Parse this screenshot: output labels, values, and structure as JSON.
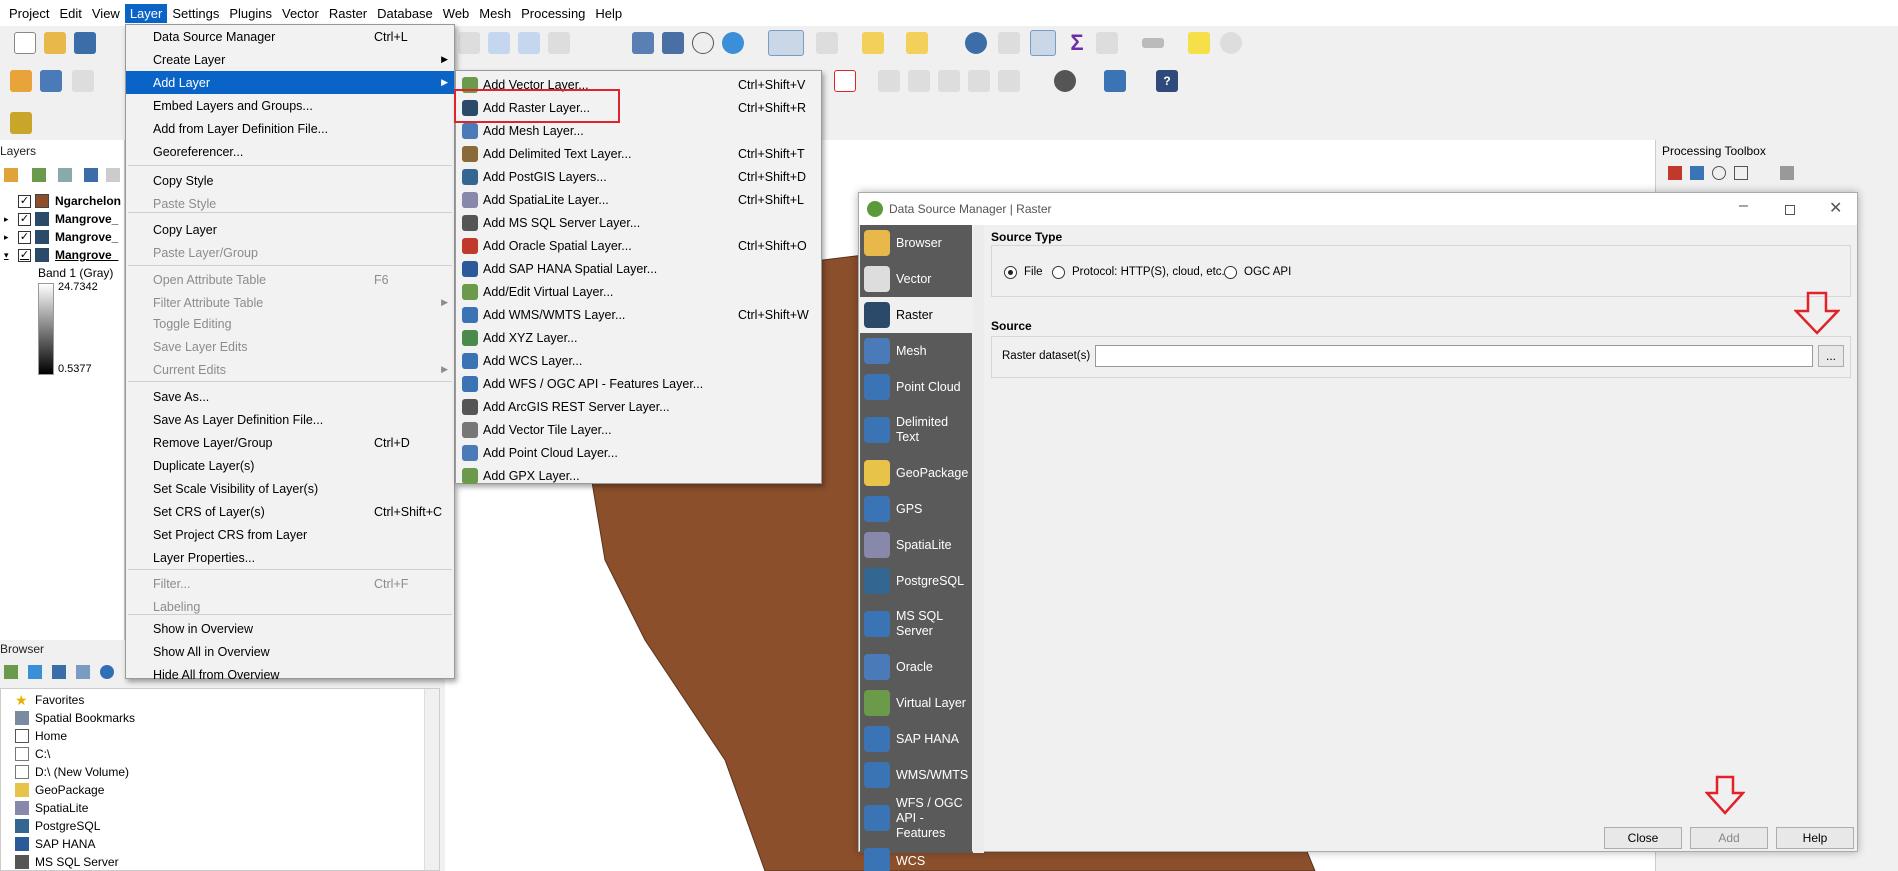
{
  "menubar": [
    "Project",
    "Edit",
    "View",
    "Layer",
    "Settings",
    "Plugins",
    "Vector",
    "Raster",
    "Database",
    "Web",
    "Mesh",
    "Processing",
    "Help"
  ],
  "layers_panel": {
    "title": "Layers",
    "layers": [
      {
        "name": "Ngarchelon",
        "checked": true
      },
      {
        "name": "Mangrove_",
        "checked": true
      },
      {
        "name": "Mangrove_",
        "checked": true
      },
      {
        "name": "Mangrove_",
        "checked": true
      }
    ],
    "band_label": "Band 1 (Gray)",
    "max_value": "24.7342",
    "min_value": "0.5377"
  },
  "browser_panel": {
    "title": "Browser",
    "items": [
      "Favorites",
      "Spatial Bookmarks",
      "Home",
      "C:\\",
      "D:\\ (New Volume)",
      "GeoPackage",
      "SpatiaLite",
      "PostgreSQL",
      "SAP HANA",
      "MS SQL Server"
    ]
  },
  "processing_toolbox": {
    "title": "Processing Toolbox"
  },
  "layer_menu": [
    {
      "label": "Data Source Manager",
      "shortcut": "Ctrl+L",
      "disabled": false
    },
    {
      "label": "Create Layer",
      "submenu": true
    },
    {
      "label": "Add Layer",
      "submenu": true,
      "highlight": true
    },
    {
      "label": "Embed Layers and Groups..."
    },
    {
      "label": "Add from Layer Definition File..."
    },
    {
      "label": "Georeferencer..."
    },
    {
      "label": "Copy Style"
    },
    {
      "label": "Paste Style",
      "disabled": true
    },
    {
      "label": "Copy Layer"
    },
    {
      "label": "Paste Layer/Group",
      "disabled": true
    },
    {
      "label": "Open Attribute Table",
      "shortcut": "F6",
      "disabled": true
    },
    {
      "label": "Filter Attribute Table",
      "submenu": true,
      "disabled": true
    },
    {
      "label": "Toggle Editing",
      "disabled": true
    },
    {
      "label": "Save Layer Edits",
      "disabled": true
    },
    {
      "label": "Current Edits",
      "submenu": true,
      "disabled": true
    },
    {
      "label": "Save As..."
    },
    {
      "label": "Save As Layer Definition File..."
    },
    {
      "label": "Remove Layer/Group",
      "shortcut": "Ctrl+D"
    },
    {
      "label": "Duplicate Layer(s)"
    },
    {
      "label": "Set Scale Visibility of Layer(s)"
    },
    {
      "label": "Set CRS of Layer(s)",
      "shortcut": "Ctrl+Shift+C"
    },
    {
      "label": "Set Project CRS from Layer"
    },
    {
      "label": "Layer Properties..."
    },
    {
      "label": "Filter...",
      "shortcut": "Ctrl+F",
      "disabled": true
    },
    {
      "label": "Labeling",
      "disabled": true
    },
    {
      "label": "Show in Overview"
    },
    {
      "label": "Show All in Overview"
    },
    {
      "label": "Hide All from Overview"
    }
  ],
  "add_layer_menu": [
    {
      "label": "Add Vector Layer...",
      "shortcut": "Ctrl+Shift+V"
    },
    {
      "label": "Add Raster Layer...",
      "shortcut": "Ctrl+Shift+R"
    },
    {
      "label": "Add Mesh Layer..."
    },
    {
      "label": "Add Delimited Text Layer...",
      "shortcut": "Ctrl+Shift+T"
    },
    {
      "label": "Add PostGIS Layers...",
      "shortcut": "Ctrl+Shift+D"
    },
    {
      "label": "Add SpatiaLite Layer...",
      "shortcut": "Ctrl+Shift+L"
    },
    {
      "label": "Add MS SQL Server Layer..."
    },
    {
      "label": "Add Oracle Spatial Layer...",
      "shortcut": "Ctrl+Shift+O"
    },
    {
      "label": "Add SAP HANA Spatial Layer..."
    },
    {
      "label": "Add/Edit Virtual Layer..."
    },
    {
      "label": "Add WMS/WMTS Layer...",
      "shortcut": "Ctrl+Shift+W"
    },
    {
      "label": "Add XYZ Layer..."
    },
    {
      "label": "Add WCS Layer..."
    },
    {
      "label": "Add WFS / OGC API - Features Layer..."
    },
    {
      "label": "Add ArcGIS REST Server Layer..."
    },
    {
      "label": "Add Vector Tile Layer..."
    },
    {
      "label": "Add Point Cloud Layer..."
    },
    {
      "label": "Add GPX Layer..."
    }
  ],
  "dialog": {
    "title": "Data Source Manager | Raster",
    "sidebar": [
      "Browser",
      "Vector",
      "Raster",
      "Mesh",
      "Point Cloud",
      "Delimited Text",
      "GeoPackage",
      "GPS",
      "SpatiaLite",
      "PostgreSQL",
      "MS SQL Server",
      "Oracle",
      "Virtual Layer",
      "SAP HANA",
      "WMS/WMTS",
      "WFS / OGC API - Features",
      "WCS"
    ],
    "selected": "Raster",
    "source_type_title": "Source Type",
    "radio_options": [
      "File",
      "Protocol: HTTP(S), cloud, etc.",
      "OGC API"
    ],
    "source_title": "Source",
    "dataset_label": "Raster dataset(s)",
    "dataset_value": "",
    "browse_button": "...",
    "buttons": {
      "close": "Close",
      "add": "Add",
      "help": "Help"
    }
  },
  "colors": {
    "map_fill": "#8b4f2c",
    "highlight": "#0a64c8",
    "annotation_red": "#e0222a"
  }
}
